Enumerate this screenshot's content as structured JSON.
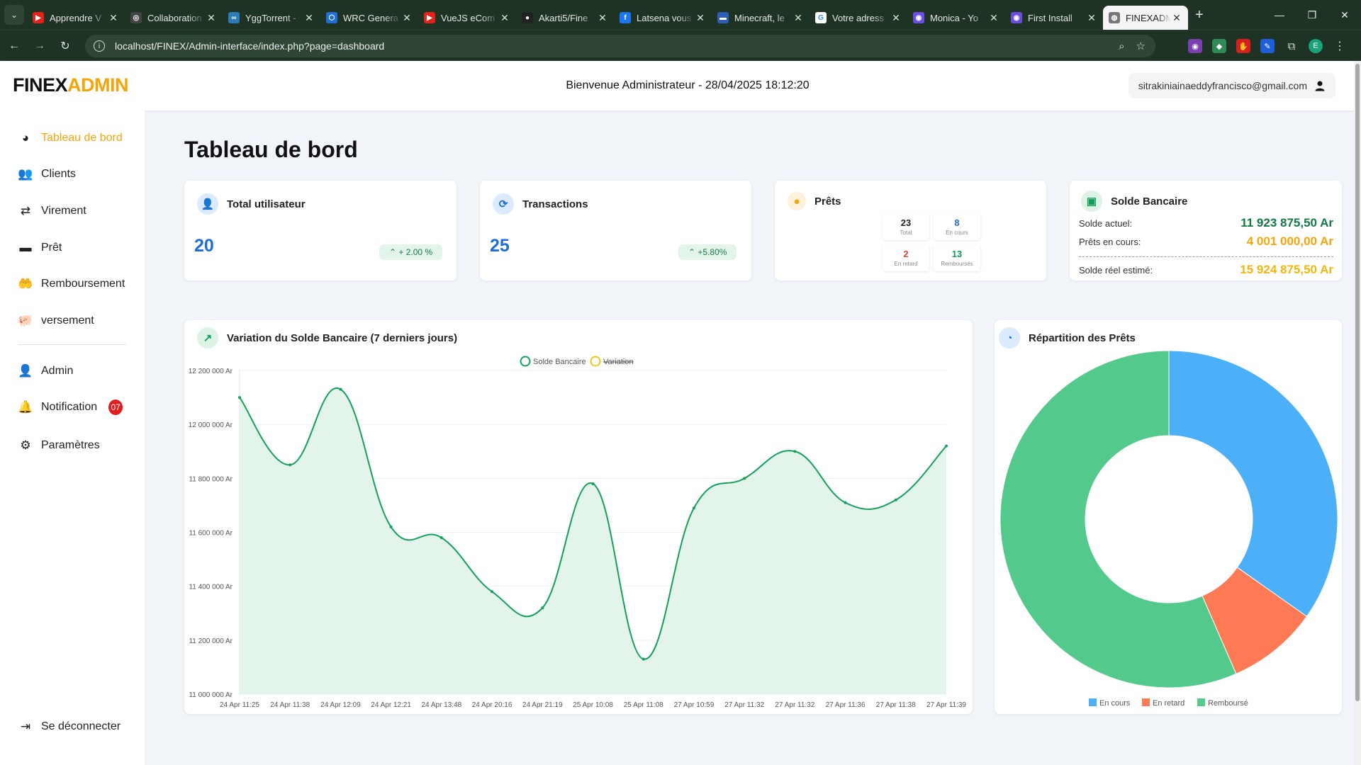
{
  "browser": {
    "tabs": [
      {
        "title": "Apprendre V",
        "fav_color": "#e62117",
        "fav_glyph": "▶"
      },
      {
        "title": "Collaboration",
        "fav_color": "#444444",
        "fav_glyph": "◎"
      },
      {
        "title": "YggTorrent -",
        "fav_color": "#2b7bb9",
        "fav_glyph": "∞"
      },
      {
        "title": "WRC Genera",
        "fav_color": "#1e6fd9",
        "fav_glyph": "⬡"
      },
      {
        "title": "VueJS eCom",
        "fav_color": "#e62117",
        "fav_glyph": "▶"
      },
      {
        "title": "Akarti5/Fine",
        "fav_color": "#222222",
        "fav_glyph": "●"
      },
      {
        "title": "Latsena vous",
        "fav_color": "#1877f2",
        "fav_glyph": "f"
      },
      {
        "title": "Minecraft, le",
        "fav_color": "#2b5fb8",
        "fav_glyph": "▬"
      },
      {
        "title": "Votre adress",
        "fav_color": "#ffffff",
        "fav_glyph": "G"
      },
      {
        "title": "Monica - Yo",
        "fav_color": "#6b4de6",
        "fav_glyph": "◉"
      },
      {
        "title": "First Install",
        "fav_color": "#6b4de6",
        "fav_glyph": "◉"
      },
      {
        "title": "FINEXADMIN",
        "fav_color": "#777777",
        "fav_glyph": "◍",
        "active": true
      }
    ],
    "url": "localhost/FINEX/Admin-interface/index.php?page=dashboard",
    "profile_initial": "E"
  },
  "header": {
    "logo_part1": "FINEX",
    "logo_part2": "ADMIN",
    "welcome": "Bienvenue Administrateur - 28/04/2025 18:12:20",
    "user_email": "sitrakiniainaeddyfrancisco@gmail.com"
  },
  "sidebar": {
    "items": [
      {
        "label": "Tableau de bord",
        "icon": "gauge-icon"
      },
      {
        "label": "Clients",
        "icon": "users-icon"
      },
      {
        "label": "Virement",
        "icon": "transfer-icon"
      },
      {
        "label": "Prêt",
        "icon": "wallet-icon"
      },
      {
        "label": "Remboursement",
        "icon": "hand-coin-icon"
      },
      {
        "label": "versement",
        "icon": "piggy-bank-icon"
      },
      {
        "label": "Admin",
        "icon": "user-icon"
      },
      {
        "label": "Notification",
        "icon": "bell-icon"
      },
      {
        "label": "Paramètres",
        "icon": "gear-icon"
      }
    ],
    "notification_count": "07",
    "logout": "Se déconnecter"
  },
  "page": {
    "title": "Tableau de bord"
  },
  "cards": {
    "users": {
      "title": "Total utilisateur",
      "value": "20",
      "trend": "+ 2.00 %"
    },
    "transactions": {
      "title": "Transactions",
      "value": "25",
      "trend": "+5.80%"
    },
    "loans": {
      "title": "Prêts",
      "total": "23",
      "total_label": "Total",
      "in_progress": "8",
      "in_progress_label": "En cours",
      "late": "2",
      "late_label": "En retard",
      "repaid": "13",
      "repaid_label": "Remboursés"
    },
    "balance": {
      "title": "Solde Bancaire",
      "current_label": "Solde actuel:",
      "current_value": "11 923 875,50 Ar",
      "loans_label": "Prêts en cours:",
      "loans_value": "4 001 000,00 Ar",
      "real_label": "Solde réel estimé:",
      "real_value": "15 924 875,50 Ar"
    }
  },
  "colors": {
    "accent": "#f5a50a",
    "blue": "#1d6fd8",
    "green": "#0f9d58",
    "line": "#13a15a",
    "pie_blue": "#4bb0f8",
    "pie_red": "#fe7a55",
    "pie_green": "#54c98c"
  },
  "chart_data": [
    {
      "type": "line",
      "title": "Variation du Solde Bancaire (7 derniers jours)",
      "legend": [
        "Solde Bancaire",
        "Variation"
      ],
      "series": [
        {
          "name": "Solde Bancaire",
          "values": [
            12100000,
            11850000,
            12130000,
            11620000,
            11580000,
            11380000,
            11320000,
            11780000,
            11130000,
            11690000,
            11800000,
            11900000,
            11710000,
            11720000,
            11920000
          ]
        }
      ],
      "x": [
        "24 Apr 11:25",
        "24 Apr 11:38",
        "24 Apr 12:09",
        "24 Apr 12:21",
        "24 Apr 13:48",
        "24 Apr 20:16",
        "24 Apr 21:19",
        "25 Apr 10:08",
        "25 Apr 11:08",
        "27 Apr 10:59",
        "27 Apr 11:32",
        "27 Apr 11:32",
        "27 Apr 11:36",
        "27 Apr 11:38",
        "27 Apr 11:39"
      ],
      "yticks": [
        "12 200 000 Ar",
        "12 000 000 Ar",
        "11 800 000 Ar",
        "11 600 000 Ar",
        "11 400 000 Ar",
        "11 200 000 Ar",
        "11 000 000 Ar"
      ],
      "ylim": [
        11000000,
        12200000
      ],
      "grid": true,
      "legend_position": "top"
    },
    {
      "type": "pie",
      "title": "Répartition des Prêts",
      "categories": [
        "En cours",
        "En retard",
        "Remboursé"
      ],
      "values": [
        8,
        2,
        13
      ],
      "legend_position": "bottom"
    }
  ]
}
